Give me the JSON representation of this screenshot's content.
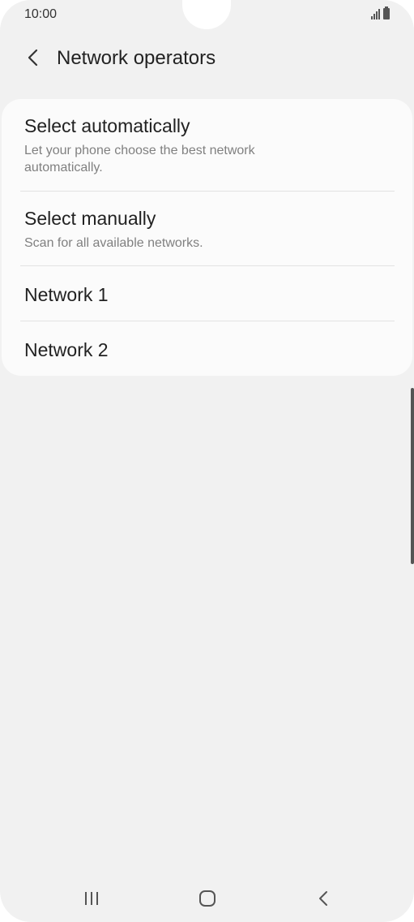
{
  "status_bar": {
    "time": "10:00"
  },
  "header": {
    "title": "Network operators",
    "back_icon": "chevron-left-icon"
  },
  "options": {
    "auto": {
      "title": "Select automatically",
      "subtitle": "Let your phone choose the best network automatically."
    },
    "manual": {
      "title": "Select manually",
      "subtitle": "Scan for all available networks."
    }
  },
  "networks": [
    {
      "label": "Network 1"
    },
    {
      "label": "Network 2"
    }
  ],
  "nav_bar": {
    "recents_icon": "recents-icon",
    "home_icon": "home-icon",
    "back_icon": "back-icon"
  }
}
